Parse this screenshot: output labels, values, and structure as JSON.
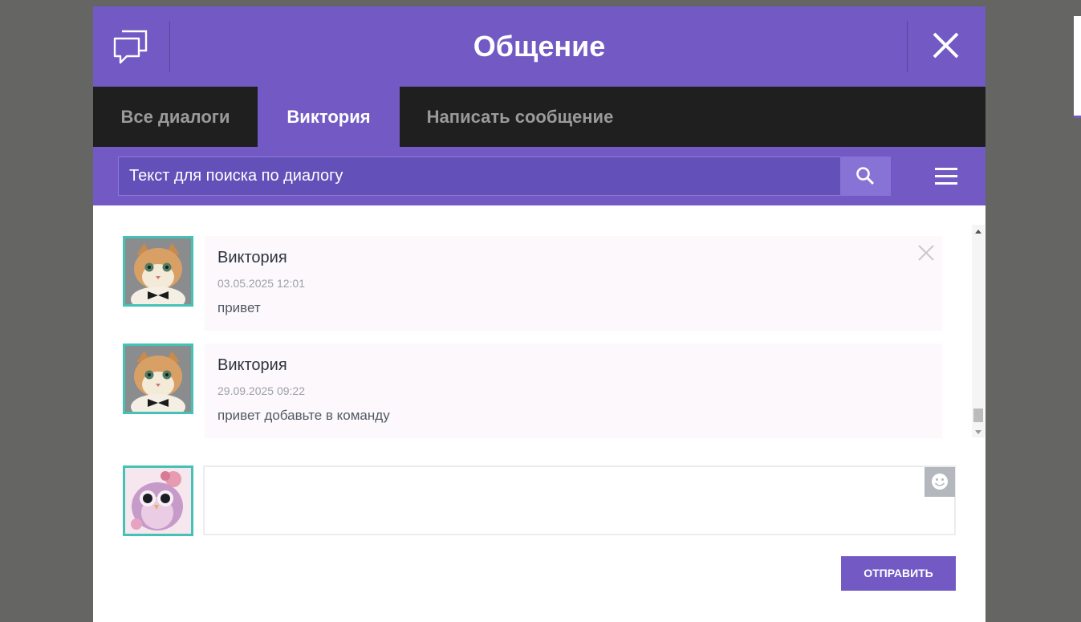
{
  "header": {
    "title": "Общение",
    "chat_icon": "chat-bubbles-icon",
    "close_icon": "close-icon"
  },
  "tabs": [
    {
      "label": "Все диалоги",
      "active": false
    },
    {
      "label": "Виктория",
      "active": true
    },
    {
      "label": "Написать сообщение",
      "active": false
    }
  ],
  "search": {
    "placeholder": "Текст для поиска по диалогу",
    "value": "",
    "search_icon": "search-icon",
    "menu_icon": "hamburger-menu-icon"
  },
  "messages": [
    {
      "sender": "Виктория",
      "date": "03.05.2025 12:01",
      "text": "привет",
      "avatar": "cat-avatar"
    },
    {
      "sender": "Виктория",
      "date": "29.09.2025 09:22",
      "text": "привет добавьте в команду",
      "avatar": "cat-avatar"
    }
  ],
  "compose": {
    "value": "",
    "avatar": "owl-avatar",
    "emoji_icon": "smiley-icon",
    "send_label": "ОТПРАВИТЬ"
  },
  "colors": {
    "accent": "#7259c4",
    "tabs_bg": "#1f1f1f",
    "avatar_border": "#44c2b6",
    "backdrop": "#656663"
  }
}
